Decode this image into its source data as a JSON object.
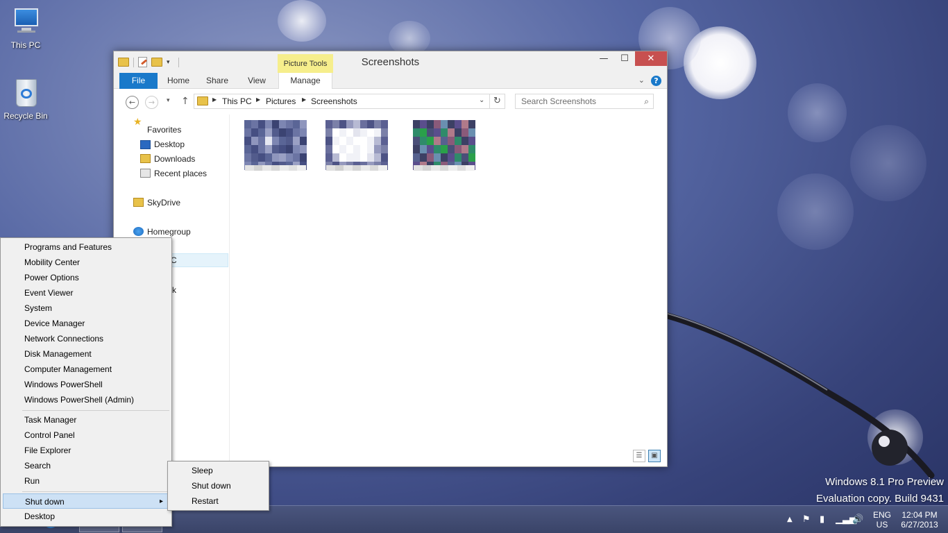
{
  "desktop": {
    "icons": [
      {
        "label": "This PC"
      },
      {
        "label": "Recycle Bin"
      }
    ]
  },
  "explorer": {
    "title": "Screenshots",
    "picture_tools_label": "Picture Tools",
    "window_controls": {
      "minimize": "—",
      "maximize": "☐",
      "close": "✕"
    },
    "ribbon_tabs": [
      "File",
      "Home",
      "Share",
      "View",
      "Manage"
    ],
    "help_label": "?",
    "address": {
      "crumbs": [
        "This PC",
        "Pictures",
        "Screenshots"
      ],
      "refresh_glyph": "↻"
    },
    "search": {
      "placeholder": "Search Screenshots",
      "icon_glyph": "⌕"
    },
    "nav": {
      "favorites": "Favorites",
      "desktop": "Desktop",
      "downloads": "Downloads",
      "recent": "Recent places",
      "skydrive": "SkyDrive",
      "homegroup": "Homegroup",
      "this_pc_fragment": "C",
      "network_fragment": "rk"
    }
  },
  "context_menu": {
    "group1": [
      "Programs and Features",
      "Mobility Center",
      "Power Options",
      "Event Viewer",
      "System",
      "Device Manager",
      "Network Connections",
      "Disk Management",
      "Computer Management",
      "Windows PowerShell",
      "Windows PowerShell (Admin)"
    ],
    "group2": [
      "Task Manager",
      "Control Panel",
      "File Explorer",
      "Search",
      "Run"
    ],
    "shut_down": "Shut down",
    "desktop": "Desktop",
    "arrow": "▸"
  },
  "submenu": [
    "Sleep",
    "Shut down",
    "Restart"
  ],
  "watermark": {
    "line1": "Windows 8.1 Pro Preview",
    "line2": "Evaluation copy. Build 9431"
  },
  "tray": {
    "language": "ENG",
    "region": "US",
    "time": "12:04 PM",
    "date": "6/27/2013"
  },
  "colors": {
    "accent": "#1979ca",
    "picture_tools": "#f6ee8c",
    "menu_highlight": "#cde1f5",
    "close_button": "#c75050"
  }
}
